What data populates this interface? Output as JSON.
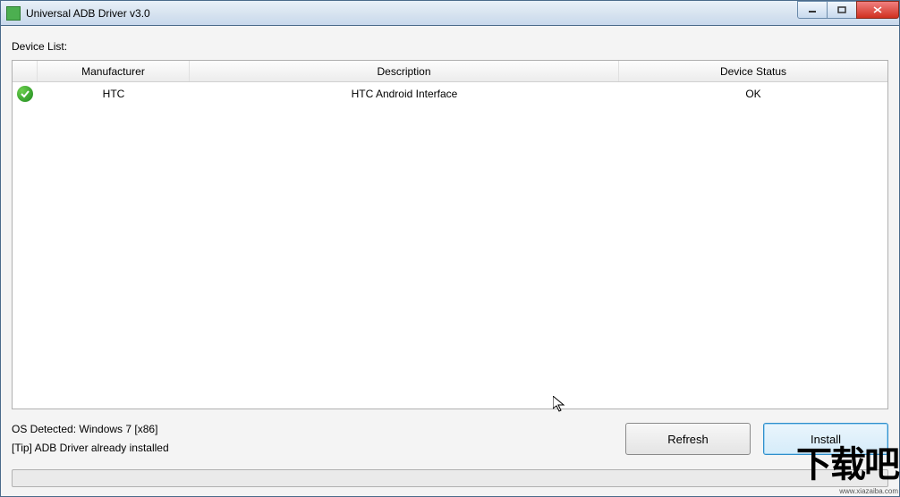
{
  "window": {
    "title": "Universal ADB Driver v3.0",
    "icon_name": "app-icon"
  },
  "labels": {
    "device_list": "Device List:",
    "os_detected_prefix": "OS Detected: ",
    "os_detected_value": "Windows 7  [x86]",
    "tip_prefix": "[Tip] ",
    "tip_text": "ADB Driver already installed"
  },
  "grid": {
    "columns": {
      "manufacturer": "Manufacturer",
      "description": "Description",
      "status": "Device Status"
    },
    "rows": [
      {
        "icon": "check",
        "manufacturer": "HTC",
        "description": "HTC Android Interface",
        "status": "OK"
      }
    ]
  },
  "buttons": {
    "refresh": "Refresh",
    "install": "Install"
  },
  "watermark": {
    "text": "下载吧",
    "url": "www.xiazaiba.com"
  },
  "colors": {
    "primary_border": "#2f8ecb",
    "success_green": "#1e8a1e"
  }
}
